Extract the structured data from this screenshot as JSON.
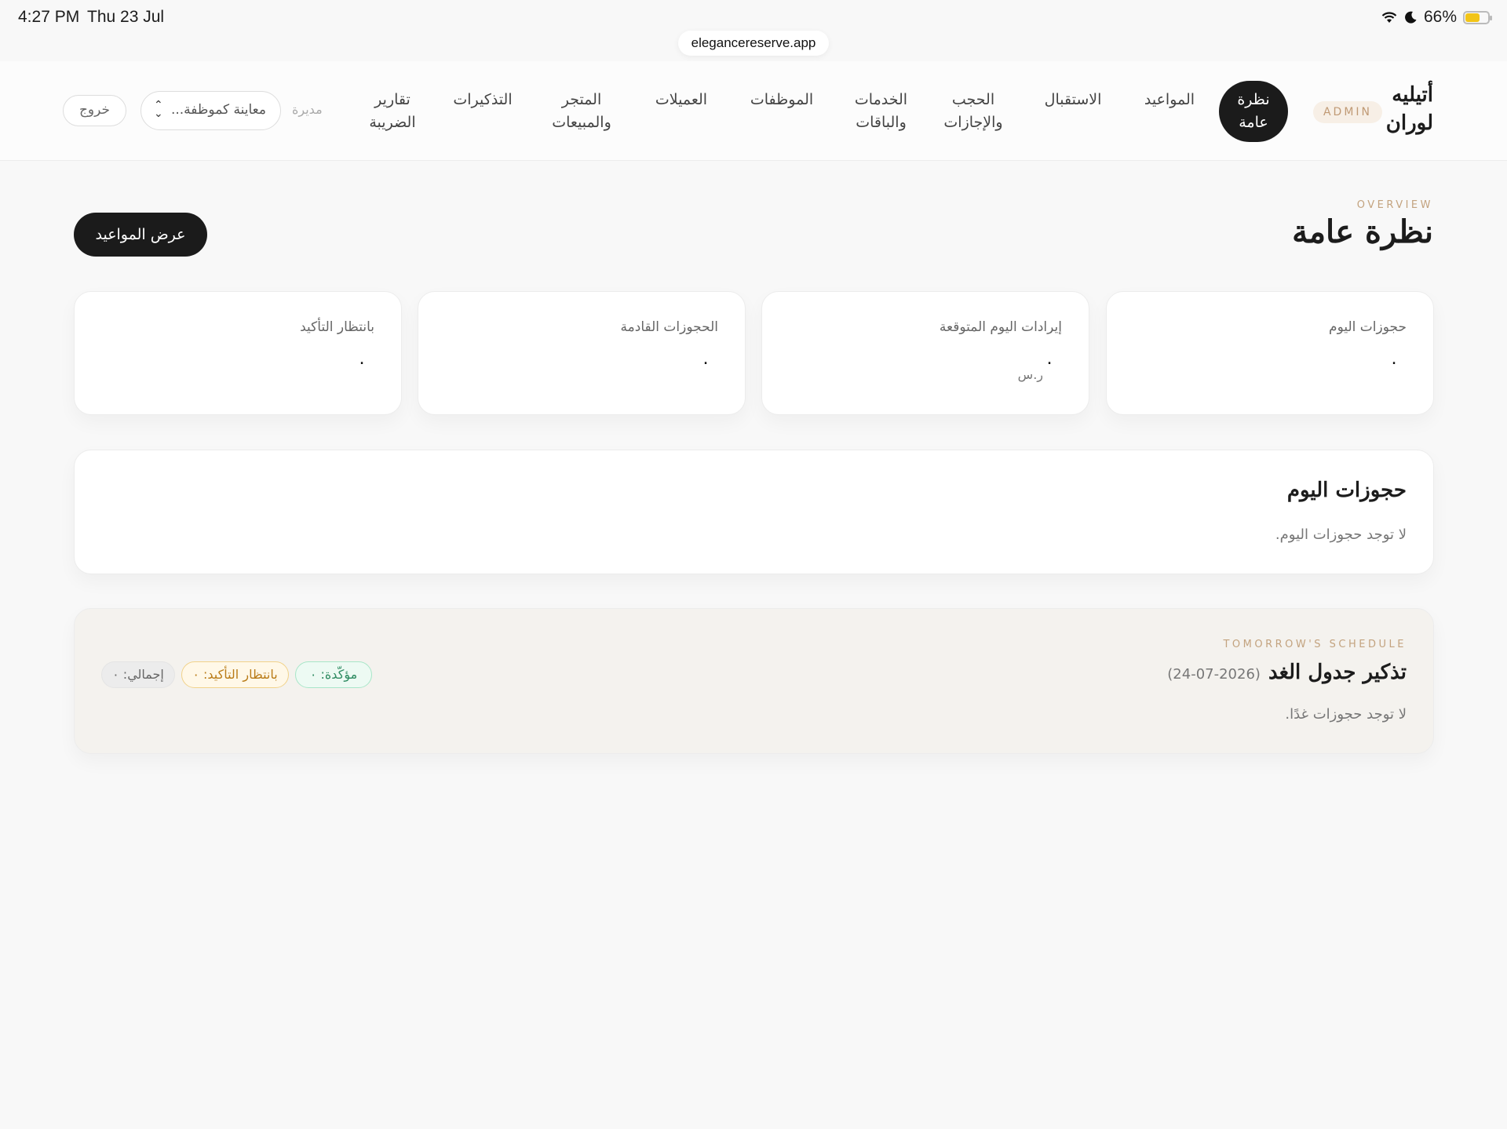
{
  "status_bar": {
    "time": "4:27 PM",
    "date": "Thu 23 Jul",
    "battery_percent": "66%",
    "battery_level": 0.66,
    "icons": [
      "wifi-icon",
      "moon-icon",
      "battery-icon"
    ]
  },
  "browser": {
    "url": "elegancereserve.app"
  },
  "header": {
    "brand": "أتيليه لوران",
    "badge": "ADMIN",
    "nav": [
      {
        "label": "نظرة عامة",
        "active": true
      },
      {
        "label": "المواعيد"
      },
      {
        "label": "الاستقبال"
      },
      {
        "label": "الحجب والإجازات"
      },
      {
        "label": "الخدمات والباقات"
      },
      {
        "label": "الموظفات"
      },
      {
        "label": "العميلات"
      },
      {
        "label": "المتجر والمبيعات"
      },
      {
        "label": "التذكيرات"
      },
      {
        "label": "تقارير الضريبة"
      }
    ],
    "role": "مديرة",
    "impersonate_placeholder": "معاينة كموظفة...",
    "logout": "خروج"
  },
  "page": {
    "eyebrow": "OVERVIEW",
    "title": "نظرة عامة",
    "view_appointments": "عرض المواعيد"
  },
  "stats": [
    {
      "label": "حجوزات اليوم",
      "value": "٠"
    },
    {
      "label": "إيرادات اليوم المتوقعة",
      "value": "٠",
      "unit": "ر.س"
    },
    {
      "label": "الحجوزات القادمة",
      "value": "٠"
    },
    {
      "label": "بانتظار التأكيد",
      "value": "٠"
    }
  ],
  "today_bookings": {
    "title": "حجوزات اليوم",
    "empty": "لا توجد حجوزات اليوم."
  },
  "tomorrow": {
    "eyebrow": "TOMORROW'S SCHEDULE",
    "title": "تذكير جدول الغد",
    "date": "(24-07-2026)",
    "confirmed": "مؤكّدة: ٠",
    "pending": "بانتظار التأكيد: ٠",
    "total": "إجمالي: ٠",
    "empty": "لا توجد حجوزات غدًا."
  },
  "colors": {
    "accent": "#c3a37f",
    "dark": "#1b1b1b",
    "confirmed": "#2e8b61",
    "pending": "#b97b17"
  }
}
